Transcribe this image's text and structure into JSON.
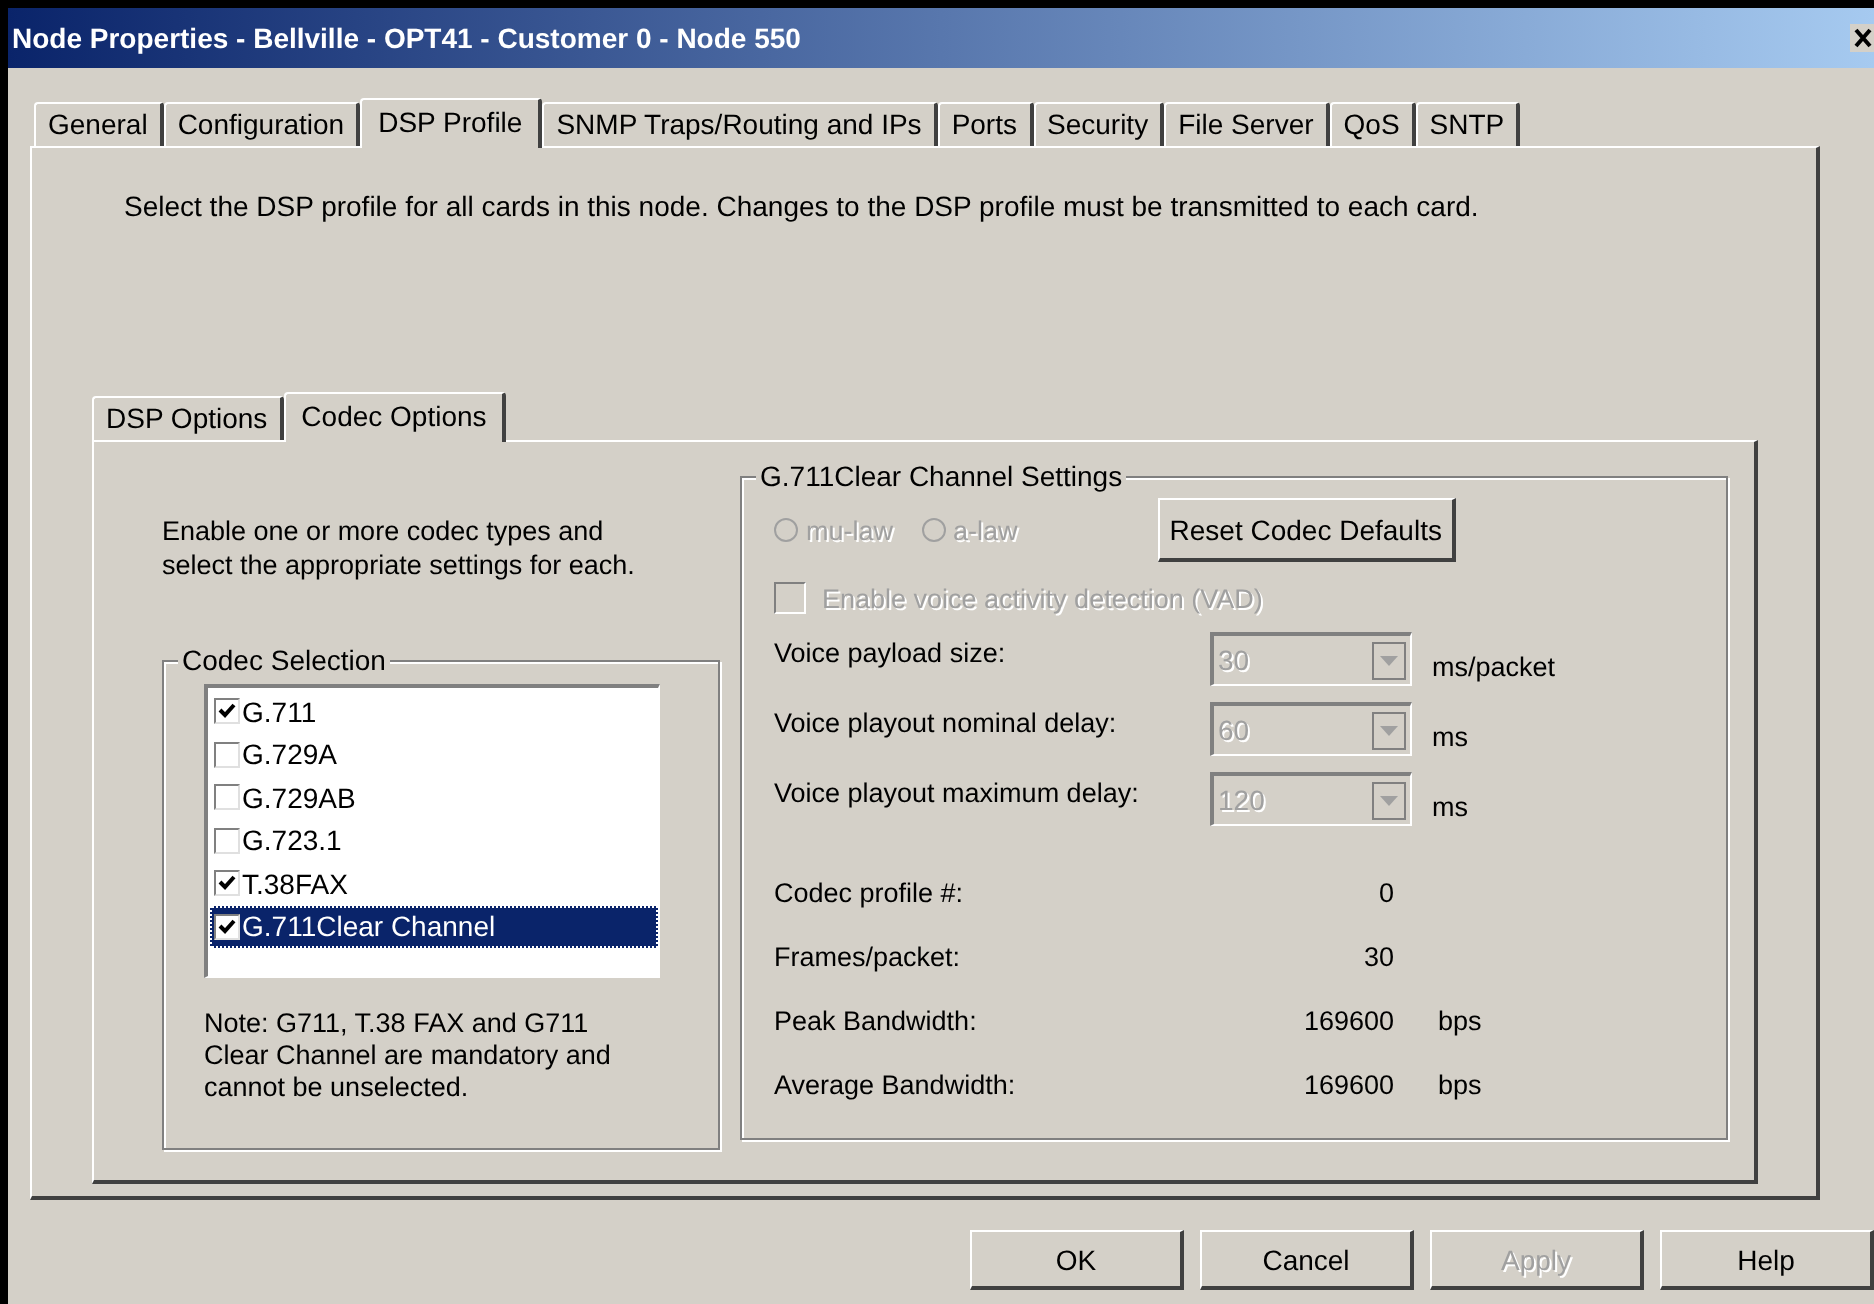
{
  "window": {
    "title": "Node Properties - Bellville - OPT41 - Customer 0 - Node 550"
  },
  "tabs": [
    {
      "label": "General",
      "selected": false
    },
    {
      "label": "Configuration",
      "selected": false
    },
    {
      "label": "DSP Profile",
      "selected": true
    },
    {
      "label": "SNMP Traps/Routing and IPs",
      "selected": false
    },
    {
      "label": "Ports",
      "selected": false
    },
    {
      "label": "Security",
      "selected": false
    },
    {
      "label": "File Server",
      "selected": false
    },
    {
      "label": "QoS",
      "selected": false
    },
    {
      "label": "SNTP",
      "selected": false
    }
  ],
  "description": "Select the DSP profile for all cards in this node. Changes to the DSP profile must be transmitted to each card.",
  "sub_tabs": [
    {
      "label": "DSP Options",
      "selected": false
    },
    {
      "label": "Codec Options",
      "selected": true
    }
  ],
  "codec_intro": "Enable one or more codec types and select the appropriate settings for each.",
  "codec_selection": {
    "title": "Codec Selection",
    "items": [
      {
        "label": "G.711",
        "checked": true,
        "selected": false
      },
      {
        "label": "G.729A",
        "checked": false,
        "selected": false
      },
      {
        "label": "G.729AB",
        "checked": false,
        "selected": false
      },
      {
        "label": "G.723.1",
        "checked": false,
        "selected": false
      },
      {
        "label": "T.38FAX",
        "checked": true,
        "selected": false
      },
      {
        "label": "G.711Clear Channel",
        "checked": true,
        "selected": true
      }
    ],
    "note": "Note: G711, T.38 FAX and G711 Clear Channel are mandatory and cannot be unselected."
  },
  "settings": {
    "title": "G.711Clear Channel Settings",
    "radios": [
      {
        "label": "mu-law",
        "selected": false,
        "disabled": true
      },
      {
        "label": "a-law",
        "selected": false,
        "disabled": true
      }
    ],
    "reset_button": "Reset Codec Defaults",
    "vad": {
      "label": "Enable voice activity detection (VAD)",
      "checked": false,
      "disabled": true
    },
    "dropdowns": [
      {
        "label": "Voice payload size:",
        "value": "30",
        "unit": "ms/packet",
        "disabled": true
      },
      {
        "label": "Voice playout nominal delay:",
        "value": "60",
        "unit": "ms",
        "disabled": true
      },
      {
        "label": "Voice playout maximum delay:",
        "value": "120",
        "unit": "ms",
        "disabled": true
      }
    ],
    "stats": [
      {
        "label": "Codec profile #:",
        "value": "0"
      },
      {
        "label": "Frames/packet:",
        "value": "30"
      },
      {
        "label": "Peak Bandwidth:",
        "value": "169600",
        "unit": "bps"
      },
      {
        "label": "Average Bandwidth:",
        "value": "169600",
        "unit": "bps"
      }
    ]
  },
  "buttons": [
    {
      "label": "OK",
      "disabled": false
    },
    {
      "label": "Cancel",
      "disabled": false
    },
    {
      "label": "Apply",
      "disabled": true
    },
    {
      "label": "Help",
      "disabled": false
    }
  ]
}
